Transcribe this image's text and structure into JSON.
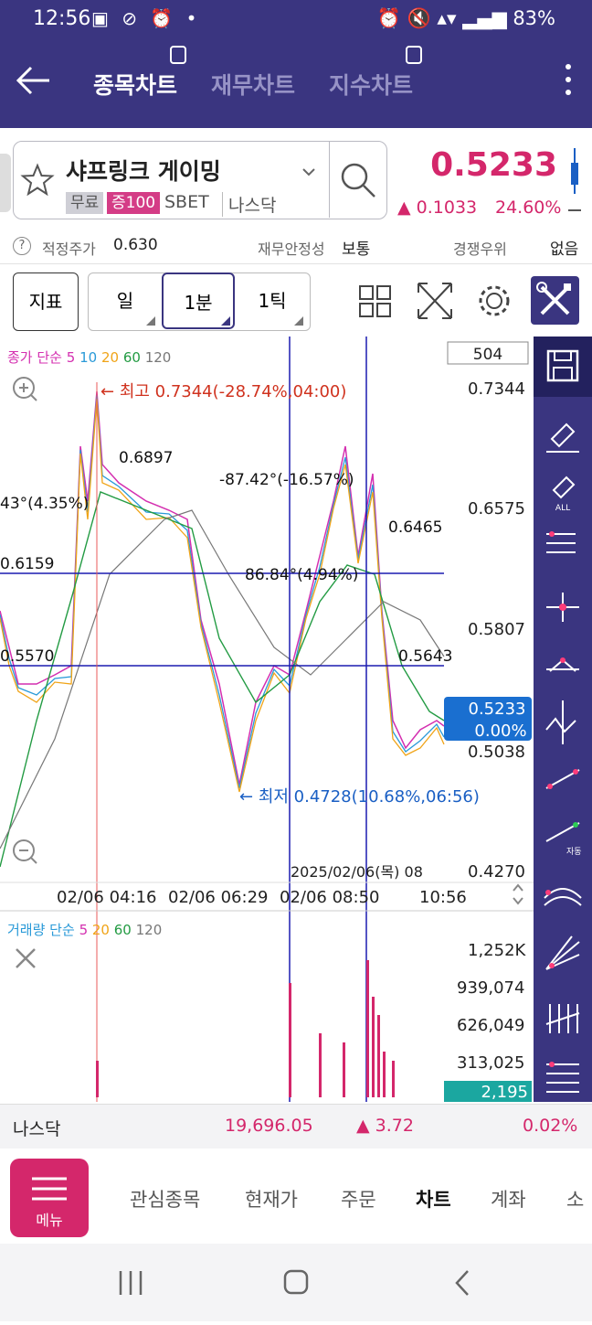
{
  "status": {
    "time": "12:56",
    "battery": "83%"
  },
  "header": {
    "tabs": [
      {
        "label": "종목차트"
      },
      {
        "label": "재무차트"
      },
      {
        "label": "지수차트"
      }
    ]
  },
  "stock": {
    "name": "샤프링크 게이밍",
    "tag_free": "무료",
    "tag_margin": "증100",
    "ticker": "SBET",
    "market": "나스닥",
    "price": "0.5233",
    "change": "0.1033",
    "change_pct": "24.60%"
  },
  "info": {
    "fair_label": "적정주가",
    "fair_value": "0.630",
    "stability_label": "재무안정성",
    "stability_value": "보통",
    "competition_label": "경쟁우위",
    "competition_value": "없음",
    "help": "?"
  },
  "toolbar": {
    "indicator": "지표",
    "periods": [
      "일",
      "1분",
      "1틱"
    ],
    "selected": "1분"
  },
  "chart": {
    "legend": {
      "prefix": "종가 단순",
      "ma": [
        "5",
        "10",
        "20",
        "60",
        "120"
      ]
    },
    "count_box": "504",
    "y_ticks": [
      "0.7344",
      "0.6575",
      "0.5807",
      "0.5038",
      "0.4270"
    ],
    "current_price": "0.5233",
    "current_pct": "0.00%",
    "high_label": "최고 0.7344(-28.74%,04:00)",
    "low_label": "최저 0.4728(10.68%,06:56)",
    "annotations": {
      "a1": "0.6897",
      "a2": "-87.42°(-16.57%)",
      "a3": "0.6465",
      "a4": "43°(4.35%)",
      "a5": "0.6159",
      "a6": "86.84°(4.94%)",
      "a7": "0.5570",
      "a8": "0.5643"
    },
    "x_labels": [
      "02/06 04:16",
      "02/06 06:29",
      "02/06 08:50",
      "10:56"
    ],
    "x_overlay": "2025/02/06(목) 08",
    "hlines": [
      0.6159,
      0.557
    ]
  },
  "volume": {
    "legend": {
      "prefix": "거래량 단순",
      "ma": [
        "5",
        "20",
        "60",
        "120"
      ]
    },
    "y_ticks": [
      "1,252K",
      "939,074",
      "626,049",
      "313,025"
    ],
    "current": "2,195"
  },
  "colors": {
    "brand": "#3a3580",
    "up": "#d4276b",
    "down": "#1a5fc4",
    "ma5": "#d42fb0",
    "ma10": "#2a9ad8",
    "ma20": "#f0a418",
    "ma60": "#239b43",
    "ma120": "#777777"
  },
  "nasdaq": {
    "name": "나스닥",
    "value": "19,696.05",
    "change": "3.72",
    "pct": "0.02%"
  },
  "bottom_nav": {
    "menu": "메뉴",
    "items": [
      "관심종목",
      "현재가",
      "주문",
      "차트",
      "계좌",
      "소"
    ],
    "active": "차트"
  }
}
